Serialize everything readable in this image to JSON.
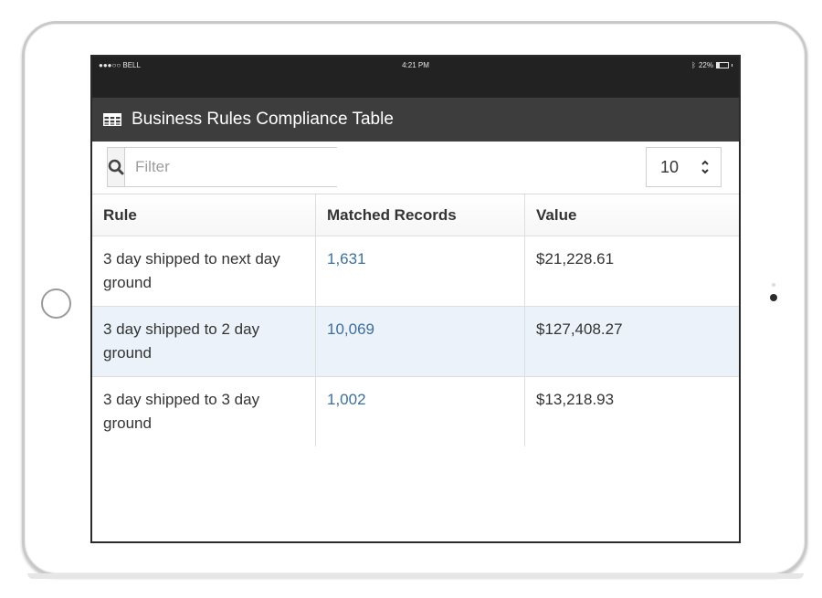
{
  "status_bar": {
    "carrier": "●●●○○ BELL",
    "time": "4:21 PM",
    "battery_percent": "22%",
    "battery_level": 0.22
  },
  "header": {
    "icon": "table-grid-icon",
    "title": "Business Rules Compliance Table"
  },
  "toolbar": {
    "search_icon": "search-icon",
    "filter_placeholder": "Filter",
    "filter_value": "",
    "page_size": "10"
  },
  "table": {
    "columns": [
      "Rule",
      "Matched Records",
      "Value"
    ],
    "rows": [
      {
        "rule": "3 day shipped to next day ground",
        "matched": "1,631",
        "value": "$21,228.61"
      },
      {
        "rule": "3 day shipped to 2 day ground",
        "matched": "10,069",
        "value": "$127,408.27"
      },
      {
        "rule": "3 day shipped to 3 day ground",
        "matched": "1,002",
        "value": "$13,218.93"
      }
    ]
  },
  "colors": {
    "header_bg": "#3d3d3d",
    "statusbar_bg": "#222222",
    "link": "#3c6fa0",
    "row_highlight": "#ebf2f9"
  }
}
